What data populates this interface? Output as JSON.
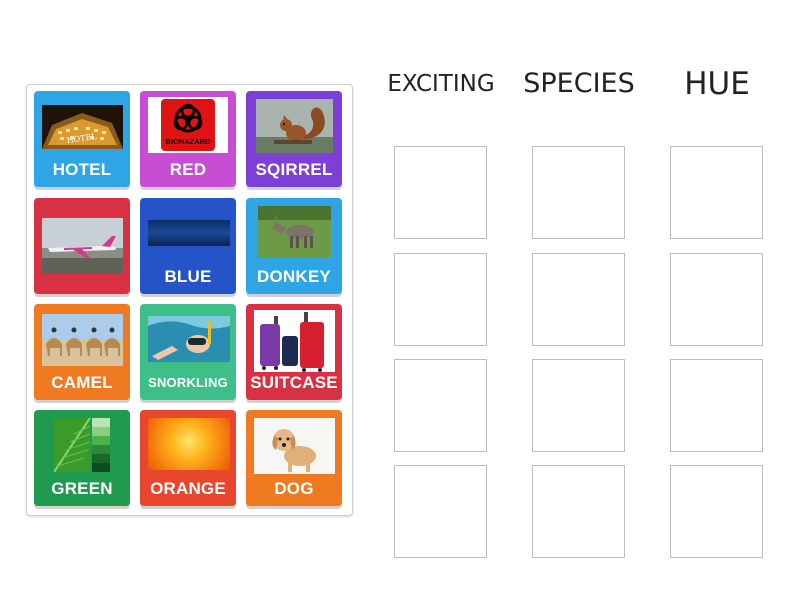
{
  "columns": [
    {
      "title": "EXCITING"
    },
    {
      "title": "SPECIES"
    },
    {
      "title": "HUE"
    }
  ],
  "cards": [
    {
      "label": "HOTEL",
      "color": "#2ea6e6",
      "image": "hotel-photo"
    },
    {
      "label": "RED",
      "color": "#c64ed2",
      "image": "biohazard-sign",
      "image_text": "BIOHAZARD"
    },
    {
      "label": "SQIRREL",
      "color": "#7e3fd6",
      "image": "squirrel-photo"
    },
    {
      "label": "",
      "color": "#d93144",
      "image": "airplane-photo"
    },
    {
      "label": "BLUE",
      "color": "#2454c8",
      "image": "blue-swatch"
    },
    {
      "label": "DONKEY",
      "color": "#2ea6e6",
      "image": "donkey-photo"
    },
    {
      "label": "CAMEL",
      "color": "#f07a22",
      "image": "camels-photo"
    },
    {
      "label": "SNORKLING",
      "color": "#3ebf8a",
      "image": "snorkeling-photo"
    },
    {
      "label": "SUITCASE",
      "color": "#d93144",
      "image": "suitcases-photo"
    },
    {
      "label": "GREEN",
      "color": "#1f9a4e",
      "image": "green-leaf-swatch"
    },
    {
      "label": "ORANGE",
      "color": "#e8462d",
      "image": "orange-swatch"
    },
    {
      "label": "DOG",
      "color": "#f07a22",
      "image": "puppy-photo"
    }
  ]
}
